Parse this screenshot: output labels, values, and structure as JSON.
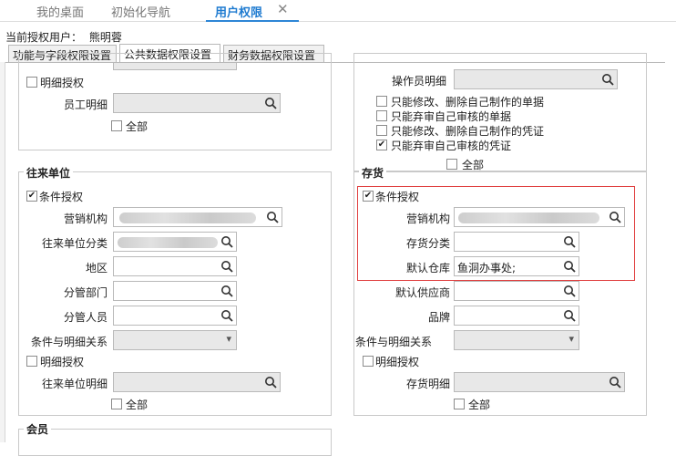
{
  "top_tabs": [
    {
      "label": "我的桌面"
    },
    {
      "label": "初始化导航"
    },
    {
      "label": "用户权限"
    }
  ],
  "user": {
    "label": "当前授权用户：",
    "name": "熊明蓉"
  },
  "sub_tabs": [
    {
      "label": "功能与字段权限设置"
    },
    {
      "label": "公共数据权限设置"
    },
    {
      "label": "财务数据权限设置"
    }
  ],
  "left_top": {
    "detail_auth": "明细授权",
    "employee_detail": "员工明细",
    "all": "全部"
  },
  "right_top": {
    "operator_detail": "操作员明细",
    "opt1": "只能修改、删除自己制作的单据",
    "opt2": "只能弃审自己审核的单据",
    "opt3": "只能修改、删除自己制作的凭证",
    "opt4": "只能弃审自己审核的凭证",
    "all": "全部"
  },
  "contacts": {
    "legend": "往来单位",
    "cond_auth": "条件授权",
    "sales_org": "营销机构",
    "category": "往来单位分类",
    "region": "地区",
    "dept": "分管部门",
    "person": "分管人员",
    "relation": "条件与明细关系",
    "detail_auth": "明细授权",
    "unit_detail": "往来单位明细",
    "all": "全部"
  },
  "inventory": {
    "legend": "存货",
    "cond_auth": "条件授权",
    "sales_org": "营销机构",
    "category": "存货分类",
    "warehouse": "默认仓库",
    "warehouse_value": "鱼洞办事处;",
    "supplier": "默认供应商",
    "brand": "品牌",
    "relation": "条件与明细关系",
    "detail_auth": "明细授权",
    "inv_detail": "存货明细",
    "all": "全部"
  },
  "member": {
    "legend": "会员"
  },
  "icons": {
    "search": "search-icon",
    "close": "close-icon",
    "chevron": "chevron-down-icon",
    "check": "check-icon"
  }
}
